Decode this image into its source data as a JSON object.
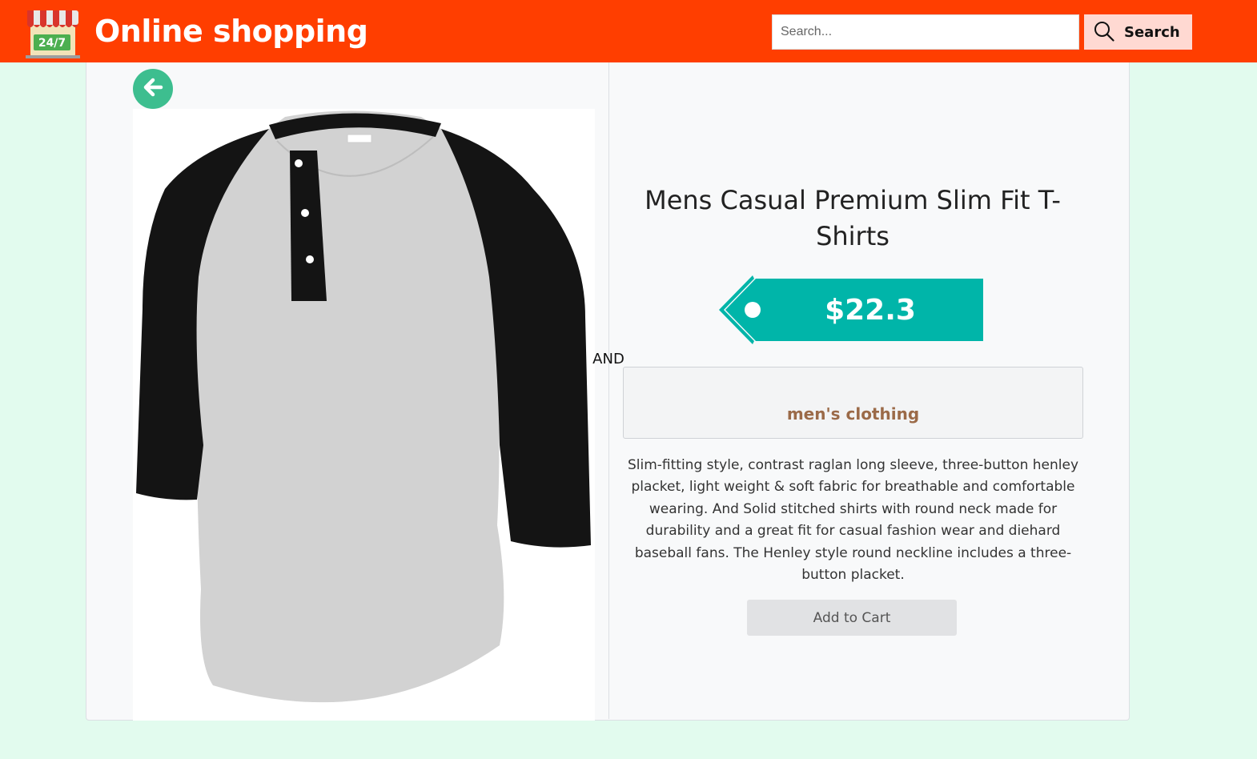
{
  "header": {
    "title": "Online shopping",
    "logo_icon": "shop-24-7-icon",
    "logo_text": "24/7",
    "background_color": "#ff3e00"
  },
  "search": {
    "placeholder": "Search...",
    "value": "",
    "button_label": "Search",
    "button_icon": "search-icon"
  },
  "navigation": {
    "back_icon": "arrow-left-icon",
    "back_color": "#3dbe8f"
  },
  "product": {
    "image_description_icon": "tshirt-image",
    "separator_text": "AND",
    "title": "Mens Casual Premium Slim Fit T-Shirts",
    "price": "$22.3",
    "price_tag_color": "#00b5a9",
    "category": "men's clothing",
    "description": "Slim-fitting style, contrast raglan long sleeve, three-button henley placket, light weight & soft fabric for breathable and comfortable wearing. And Solid stitched shirts with round neck made for durability and a great fit for casual fashion wear and diehard baseball fans. The Henley style round neckline includes a three-button placket.",
    "add_to_cart_label": "Add to Cart"
  }
}
